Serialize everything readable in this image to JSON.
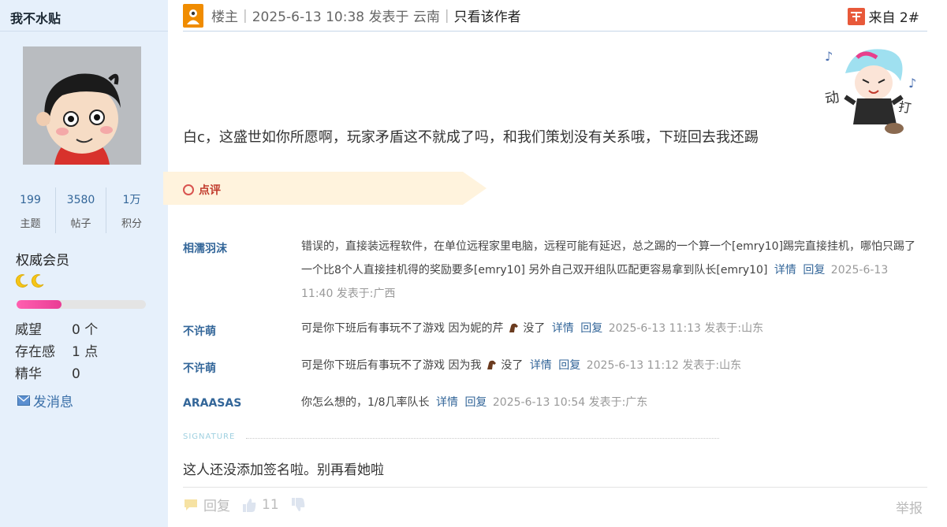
{
  "user": {
    "name": "我不水贴",
    "stats": [
      {
        "value": "199",
        "label": "主题"
      },
      {
        "value": "3580",
        "label": "帖子"
      },
      {
        "value": "1万",
        "label": "积分"
      }
    ],
    "group": "权威会员",
    "level_progress": 0.35,
    "attributes": [
      {
        "key": "威望",
        "value": "0 个"
      },
      {
        "key": "存在感",
        "value": "1 点"
      },
      {
        "key": "精华",
        "value": "0"
      }
    ],
    "send_message": "发消息",
    "accent_color": "#336699"
  },
  "header": {
    "role": "楼主",
    "time_location": "2025-6-13 10:38 发表于 云南",
    "only_author": "只看该作者",
    "floor": "来自 2#"
  },
  "post": {
    "text": "白c，这盛世如你所愿啊，玩家矛盾这不就成了吗，和我们策划没有关系哦，下班回去我还踢"
  },
  "comments_section": {
    "label": "点评",
    "detail_label": "详情",
    "reply_label": "回复",
    "items": [
      {
        "user": "相濡羽沫",
        "text": "错误的，直接装远程软件，在单位远程家里电脑，远程可能有延迟，总之踢的一个算一个[emry10]踢完直接挂机，哪怕只踢了一个比8个人直接挂机得的奖励要多[emry10] 另外自己双开组队匹配更容易拿到队长[emry10]",
        "meta": "2025-6-13 11:40 发表于:广西"
      },
      {
        "user": "不许萌",
        "text": "可是你下班后有事玩不了游戏 因为妮的芹",
        "text2": "没了",
        "meta": "2025-6-13 11:13 发表于:山东"
      },
      {
        "user": "不许萌",
        "text": "可是你下班后有事玩不了游戏 因为我",
        "text2": "没了",
        "meta": "2025-6-13 11:12 发表于:山东"
      },
      {
        "user": "ARAASAS",
        "text": "你怎么想的，1/8几率队长",
        "meta": "2025-6-13 10:54 发表于:广东"
      }
    ]
  },
  "signature": {
    "label": "SIGNATURE",
    "text": "这人还没添加签名啦。别再看她啦"
  },
  "footer": {
    "reply": "回复",
    "likes": "11",
    "report": "举报"
  }
}
